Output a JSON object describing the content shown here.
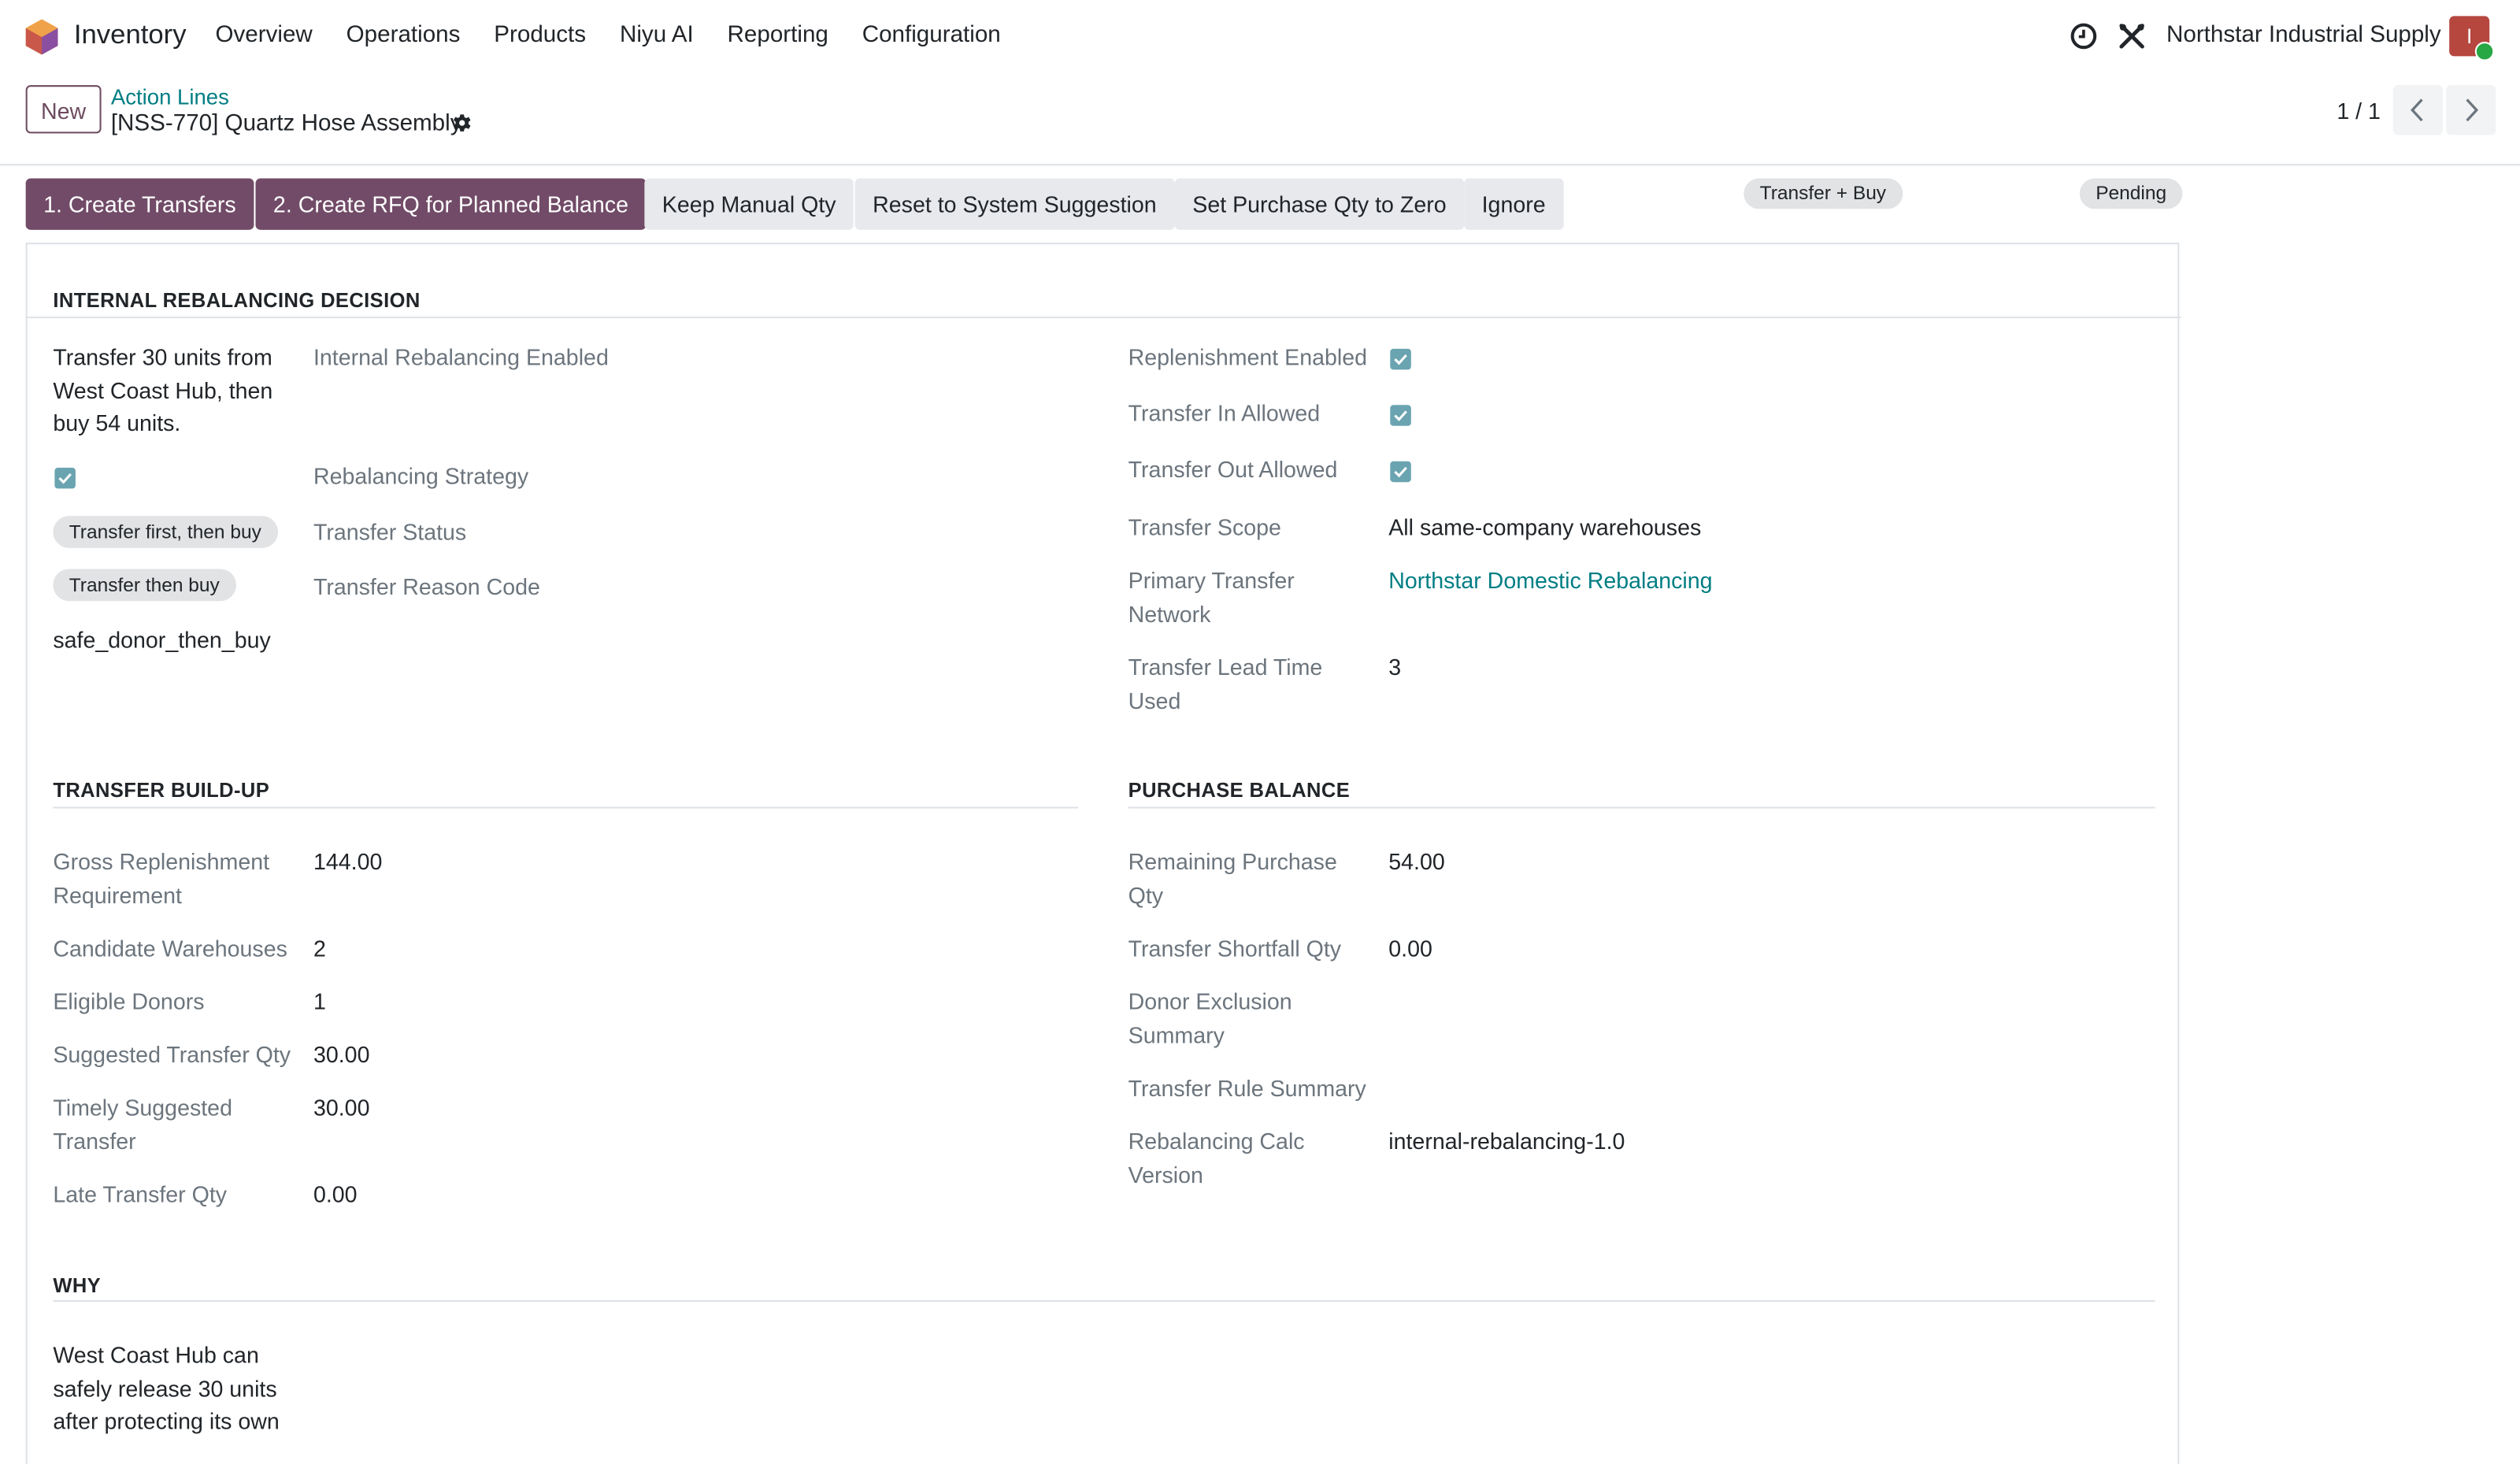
{
  "navbar": {
    "app_name": "Inventory",
    "menu": [
      "Overview",
      "Operations",
      "Products",
      "Niyu AI",
      "Reporting",
      "Configuration"
    ],
    "company": "Northstar Industrial Supply",
    "avatar_letter": "I",
    "avatar_color": "#b5473f"
  },
  "control_panel": {
    "new_label": "New",
    "breadcrumb_parent": "Action Lines",
    "breadcrumb_current": "[NSS-770] Quartz Hose Assembly",
    "pager": "1 / 1"
  },
  "statusbar": {
    "buttons": [
      "1. Create Transfers",
      "2. Create RFQ for Planned Balance",
      "Keep Manual Qty",
      "Reset to System Suggestion",
      "Set Purchase Qty to Zero",
      "Ignore"
    ],
    "pills": [
      "Transfer + Buy",
      "Pending"
    ],
    "accent": "#714b67"
  },
  "internal_rebalancing": {
    "title": "INTERNAL REBALANCING DECISION",
    "summary": "Transfer 30 units from West Coast Hub, then buy 54 units.",
    "left_labels": [
      "Internal Rebalancing Enabled",
      "Rebalancing Strategy",
      "Transfer Status",
      "Transfer Reason Code"
    ],
    "strategy_tag": "Transfer first, then buy",
    "status_tag": "Transfer then buy",
    "reason_code": "safe_donor_then_buy",
    "right": {
      "replenishment_enabled": "Replenishment Enabled",
      "transfer_in_allowed": "Transfer In Allowed",
      "transfer_out_allowed": "Transfer Out Allowed",
      "transfer_scope_label": "Transfer Scope",
      "transfer_scope_value": "All same-company warehouses",
      "primary_network_label": "Primary Transfer Network",
      "primary_network_value": "Northstar Domestic Rebalancing",
      "lead_time_label": "Transfer Lead Time Used",
      "lead_time_value": "3"
    }
  },
  "transfer_buildup": {
    "title": "TRANSFER BUILD-UP",
    "rows": [
      {
        "label": "Gross Replenishment Requirement",
        "value": "144.00"
      },
      {
        "label": "Candidate Warehouses",
        "value": "2"
      },
      {
        "label": "Eligible Donors",
        "value": "1"
      },
      {
        "label": "Suggested Transfer Qty",
        "value": "30.00"
      },
      {
        "label": "Timely Suggested Transfer",
        "value": "30.00"
      },
      {
        "label": "Late Transfer Qty",
        "value": "0.00"
      }
    ]
  },
  "purchase_balance": {
    "title": "PURCHASE BALANCE",
    "rows": [
      {
        "label": "Remaining Purchase Qty",
        "value": "54.00"
      },
      {
        "label": "Transfer Shortfall Qty",
        "value": "0.00"
      },
      {
        "label": "Donor Exclusion Summary",
        "value": ""
      },
      {
        "label": "Transfer Rule Summary",
        "value": ""
      },
      {
        "label": "Rebalancing Calc Version",
        "value": "internal-rebalancing-1.0"
      }
    ]
  },
  "why": {
    "title": "WHY",
    "text": "West Coast Hub can safely release 30 units after protecting its own"
  }
}
